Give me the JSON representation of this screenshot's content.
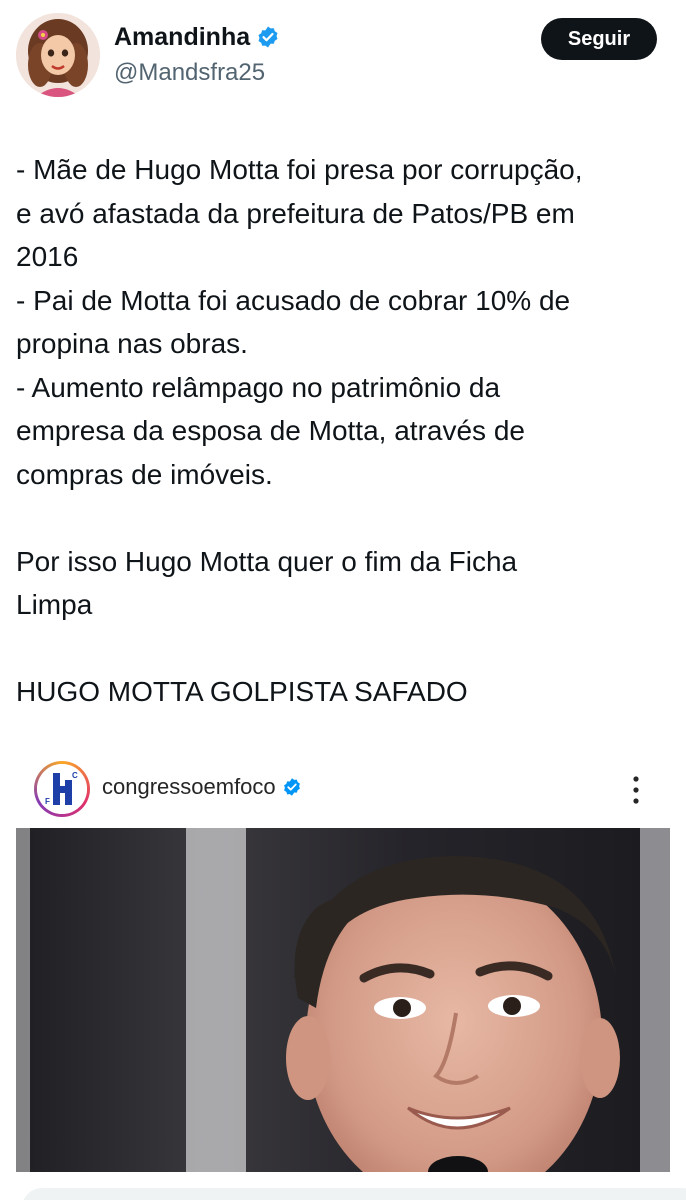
{
  "author": {
    "display_name": "Amandinha",
    "handle": "@Mandsfra25",
    "verified": true,
    "avatar_icon": "avatar-cartoon-woman"
  },
  "follow_button_label": "Seguir",
  "tweet": {
    "lines": [
      "- Mãe de Hugo Motta foi presa por corrupção,",
      "e avó afastada da prefeitura de Patos/PB em",
      "2016",
      "- Pai de Motta foi acusado de cobrar 10% de",
      "propina nas obras.",
      "- Aumento relâmpago no patrimônio da",
      "empresa da esposa de Motta, através de",
      "compras de imóveis.",
      "",
      "Por isso Hugo Motta quer o fim da Ficha",
      "Limpa",
      "",
      "HUGO MOTTA GOLPISTA SAFADO"
    ]
  },
  "embed": {
    "account_name": "congressoemfoco",
    "verified": true,
    "logo_icon": "congresso-em-foco-logo",
    "more_icon": "more-vertical-icon",
    "photo_description_icon": "person-photo"
  },
  "colors": {
    "text_primary": "#0f1419",
    "text_secondary": "#536471",
    "verified_blue": "#1d9bf0",
    "button_bg": "#0f1419",
    "button_text": "#ffffff"
  }
}
